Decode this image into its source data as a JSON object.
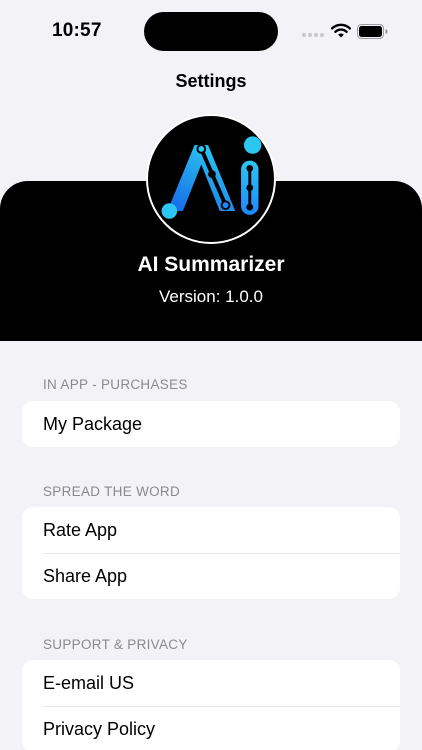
{
  "status_bar": {
    "time": "10:57"
  },
  "nav": {
    "title": "Settings"
  },
  "header": {
    "app_name": "AI Summarizer",
    "version": "Version: 1.0.0",
    "logo_icon": "ai-logo-icon",
    "logo_colors": [
      "#1e90ff",
      "#28c8f0"
    ]
  },
  "sections": [
    {
      "title": "IN APP - PURCHASES",
      "items": [
        {
          "label": "My Package"
        }
      ]
    },
    {
      "title": "SPREAD THE WORD",
      "items": [
        {
          "label": "Rate App"
        },
        {
          "label": "Share App"
        }
      ]
    },
    {
      "title": "SUPPORT & PRIVACY",
      "items": [
        {
          "label": "E-email US"
        },
        {
          "label": "Privacy Policy"
        }
      ]
    }
  ]
}
